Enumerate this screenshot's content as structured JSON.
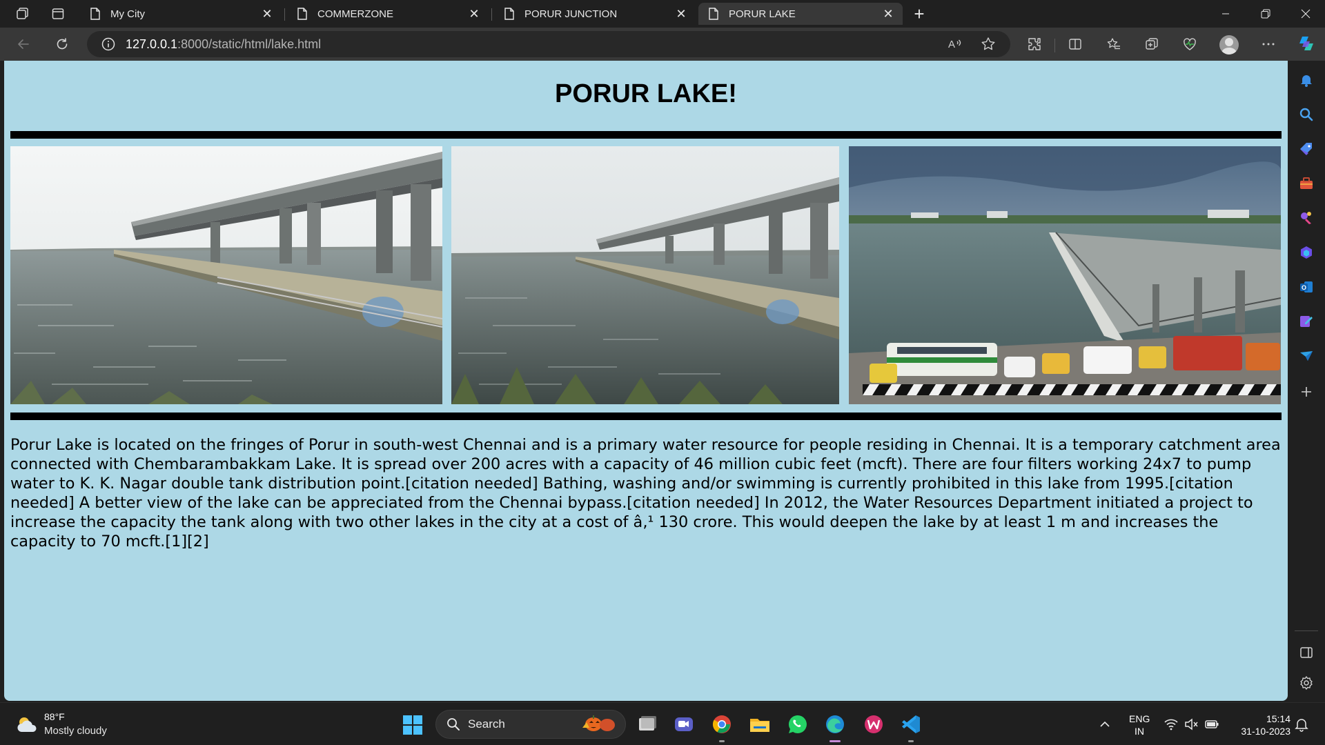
{
  "browser": {
    "tabs": [
      {
        "title": "My City",
        "active": false
      },
      {
        "title": "COMMERZONE",
        "active": false
      },
      {
        "title": "PORUR JUNCTION",
        "active": false
      },
      {
        "title": "PORUR LAKE",
        "active": true
      }
    ],
    "address": {
      "host": "127.0.0.1",
      "path": ":8000/static/html/lake.html"
    }
  },
  "page": {
    "title": "PORUR LAKE!",
    "paragraph": "Porur Lake is located on the fringes of Porur in south-west Chennai and is a primary water resource for people residing in Chennai. It is a temporary catchment area connected with Chembarambakkam Lake. It is spread over 200 acres with a capacity of 46 million cubic feet (mcft). There are four filters working 24x7 to pump water to K. K. Nagar double tank distribution point.[citation needed] Bathing, washing and/or swimming is currently prohibited in this lake from 1995.[citation needed] A better view of the lake can be appreciated from the Chennai bypass.[citation needed] In 2012, the Water Resources Department initiated a project to increase the capacity the tank along with two other lakes in the city at a cost of â‚¹ 130 crore. This would deepen the lake by at least 1 m and increases the capacity to 70 mcft.[1][2]"
  },
  "taskbar": {
    "weather_temp": "88°F",
    "weather_desc": "Mostly cloudy",
    "search_label": "Search",
    "lang_line1": "ENG",
    "lang_line2": "IN",
    "time": "15:14",
    "date": "31-10-2023"
  }
}
